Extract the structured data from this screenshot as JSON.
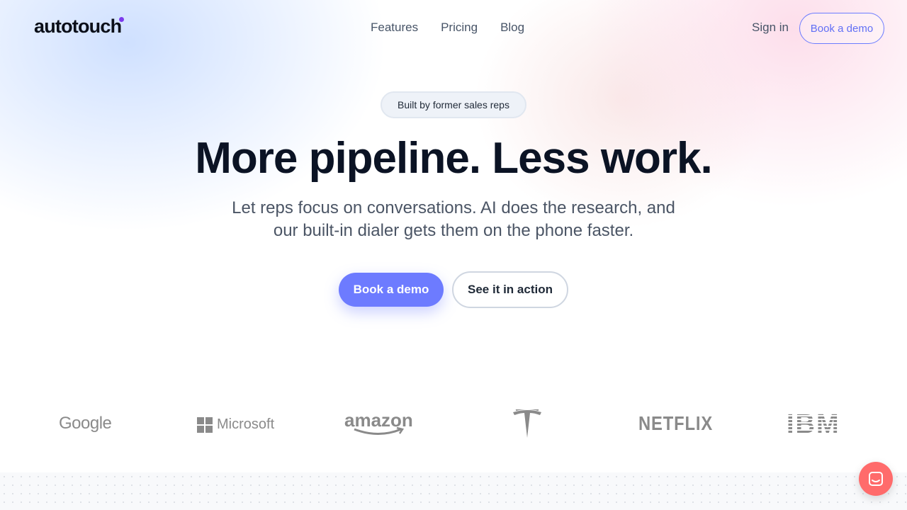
{
  "header": {
    "logo": "autotouch",
    "nav": [
      {
        "label": "Features"
      },
      {
        "label": "Pricing"
      },
      {
        "label": "Blog"
      }
    ],
    "sign_in": "Sign in",
    "book_demo": "Book a demo"
  },
  "hero": {
    "badge": "Built by former sales reps",
    "headline": "More pipeline. Less work.",
    "subtext_line1": "Let reps focus on conversations. AI does the research, and",
    "subtext_line2": "our built-in dialer gets them on the phone faster.",
    "primary_cta": "Book a demo",
    "secondary_cta": "See it in action"
  },
  "logos": {
    "google": "Google",
    "microsoft": "Microsoft",
    "amazon": "amazon",
    "netflix": "NETFLIX",
    "ibm": "IBM"
  },
  "colors": {
    "accent": "#6d7bff",
    "chat": "#ff6b6b",
    "logo_dot": "#7c3aed"
  },
  "icons": {
    "tesla": "tesla-logo-icon",
    "chat": "chat-bubble-icon"
  }
}
